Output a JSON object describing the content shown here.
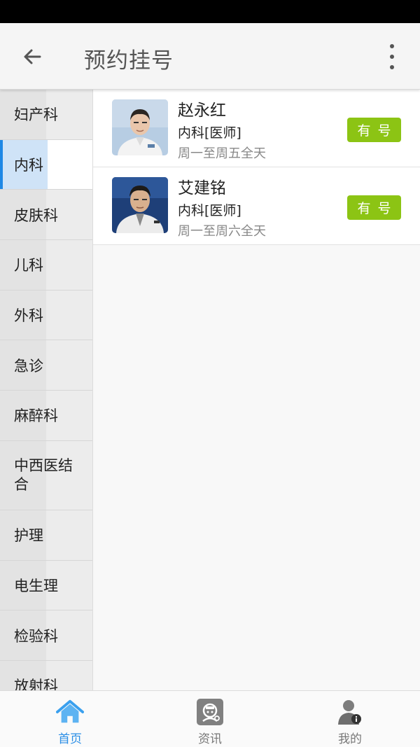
{
  "app_bar": {
    "title": "预约挂号"
  },
  "sidebar": {
    "departments": [
      {
        "label": "妇产科"
      },
      {
        "label": "内科"
      },
      {
        "label": "皮肤科"
      },
      {
        "label": "儿科"
      },
      {
        "label": "外科"
      },
      {
        "label": "急诊"
      },
      {
        "label": "麻醉科"
      },
      {
        "label": "中西医结合"
      },
      {
        "label": "护理"
      },
      {
        "label": "电生理"
      },
      {
        "label": "检验科"
      },
      {
        "label": "放射科"
      }
    ],
    "selected": "内科"
  },
  "doctors": [
    {
      "name": "赵永红",
      "dept": "内科[医师]",
      "schedule": "周一至周五全天",
      "status": "有号"
    },
    {
      "name": "艾建铭",
      "dept": "内科[医师]",
      "schedule": "周一至周六全天",
      "status": "有号"
    }
  ],
  "bottom_nav": [
    {
      "label": "首页",
      "icon": "home-icon",
      "active": true
    },
    {
      "label": "资讯",
      "icon": "news-icon",
      "active": false
    },
    {
      "label": "我的",
      "icon": "profile-icon",
      "active": false
    }
  ],
  "colors": {
    "accent": "#1e88e5",
    "available": "#8cc414",
    "nav_active": "#2a8ee6"
  }
}
